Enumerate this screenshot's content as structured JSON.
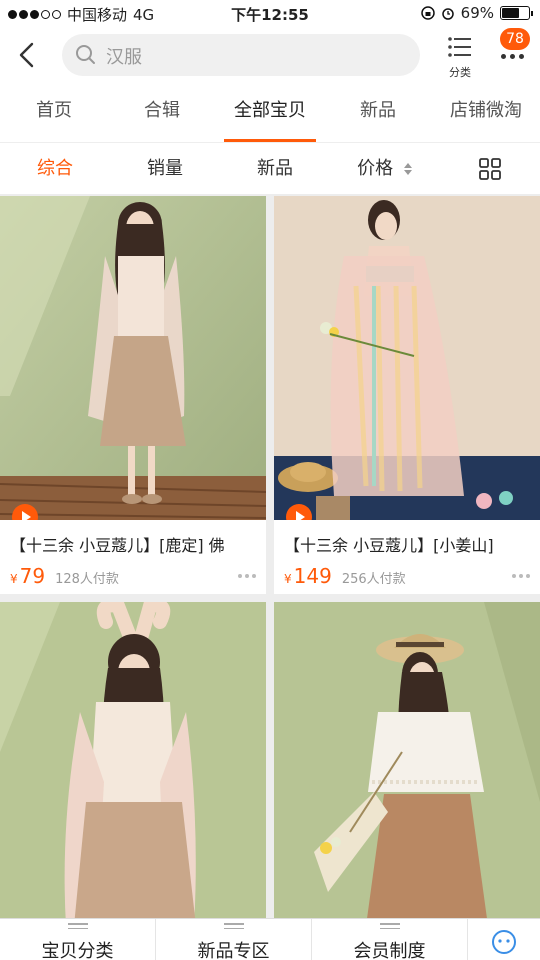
{
  "status_bar": {
    "carrier": "中国移动",
    "network": "4G",
    "time": "下午12:55",
    "battery": "69%",
    "battery_level": 0.69,
    "signal_dots_filled": 3
  },
  "nav": {
    "search_placeholder": "汉服",
    "category_label": "分类",
    "more_badge": "78"
  },
  "tabs": [
    {
      "label": "首页"
    },
    {
      "label": "合辑"
    },
    {
      "label": "全部宝贝",
      "active": true
    },
    {
      "label": "新品"
    },
    {
      "label": "店铺微淘"
    }
  ],
  "sort": [
    {
      "label": "综合",
      "active": true
    },
    {
      "label": "销量"
    },
    {
      "label": "新品"
    },
    {
      "label": "价格"
    }
  ],
  "products": [
    {
      "title": "【十三余 小豆蔻儿】[鹿定] 佛",
      "currency": "¥",
      "price": "79",
      "paid": "128人付款",
      "has_video": true
    },
    {
      "title": "【十三余 小豆蔻儿】[小姜山]",
      "currency": "¥",
      "price": "149",
      "paid": "256人付款",
      "has_video": true
    },
    {
      "has_video": false
    },
    {
      "has_video": false
    }
  ],
  "bottom_bar": [
    {
      "label": "宝贝分类"
    },
    {
      "label": "新品专区"
    },
    {
      "label": "会员制度"
    }
  ],
  "colors": {
    "accent": "#ff5a0a",
    "photo_green": "#b8c59a",
    "photo_cream": "#e6d6c4"
  }
}
